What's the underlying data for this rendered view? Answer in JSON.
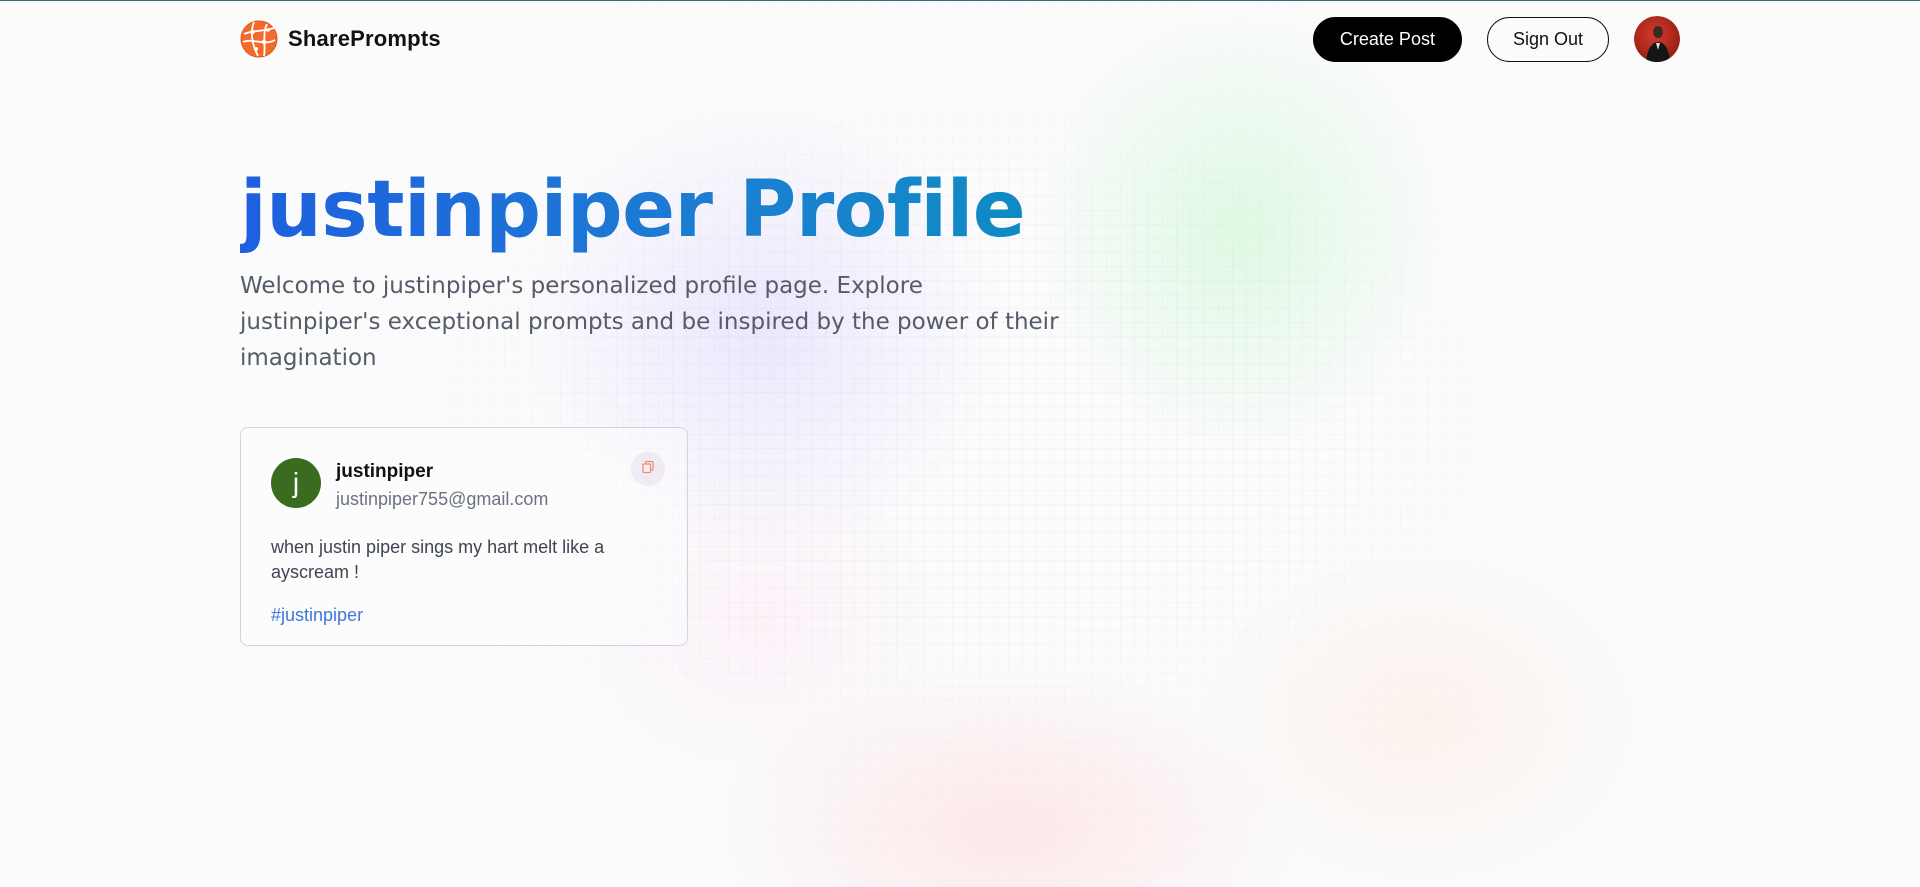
{
  "nav": {
    "brand_name": "SharePrompts",
    "create_post_label": "Create Post",
    "sign_out_label": "Sign Out",
    "logo_icon": "globe-logo-icon",
    "avatar_icon": "user-avatar-photo"
  },
  "hero": {
    "title": "justinpiper Profile",
    "description": "Welcome to justinpiper's personalized profile page. Explore justinpiper's exceptional prompts and be inspired by the power of their imagination"
  },
  "prompts": [
    {
      "avatar_letter": "j",
      "username": "justinpiper",
      "email": "justinpiper755@gmail.com",
      "text": "when justin piper sings my hart melt like a ayscream !",
      "tag": "#justinpiper",
      "copy_icon": "copy-icon"
    }
  ],
  "colors": {
    "brand_orange": "#f26b2d",
    "title_gradient_start": "#1f5fe0",
    "title_gradient_end": "#0a8fbf",
    "tag_blue": "#3f78d6",
    "card_avatar_green": "#3a6c20",
    "button_dark": "#000000"
  }
}
